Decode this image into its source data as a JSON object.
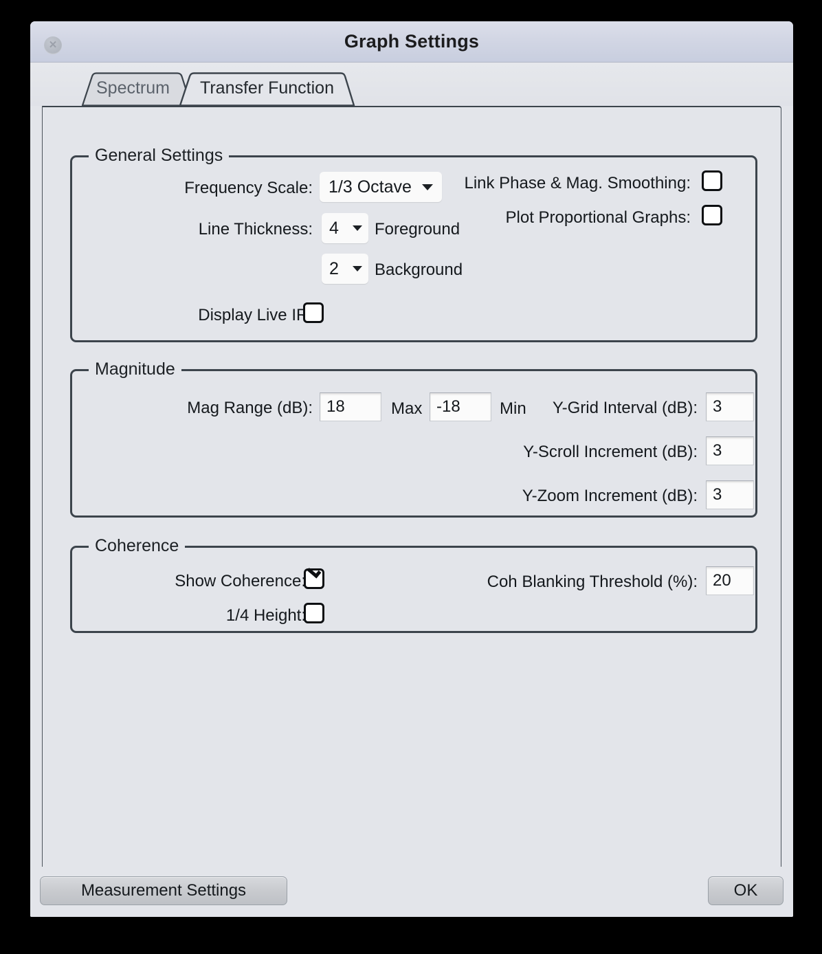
{
  "window": {
    "title": "Graph Settings",
    "close_icon": "close-icon",
    "close_glyph": "✕"
  },
  "tabs": [
    {
      "label": "Spectrum",
      "selected": false
    },
    {
      "label": "Transfer Function",
      "selected": true
    }
  ],
  "general": {
    "title": "General Settings",
    "frequency_scale": {
      "label": "Frequency Scale:",
      "value": "1/3 Octave"
    },
    "line_thickness": {
      "label": "Line Thickness:"
    },
    "foreground": {
      "value": "4",
      "label": "Foreground"
    },
    "background": {
      "value": "2",
      "label": "Background"
    },
    "display_live_ir": {
      "label": "Display Live IR:",
      "checked": false
    },
    "link_phase": {
      "label": "Link Phase & Mag. Smoothing:",
      "checked": false
    },
    "plot_proportional": {
      "label": "Plot Proportional Graphs:",
      "checked": false
    }
  },
  "magnitude": {
    "title": "Magnitude",
    "mag_range": {
      "label": "Mag Range (dB):",
      "max_value": "18",
      "max_label": "Max",
      "min_value": "-18",
      "min_label": "Min"
    },
    "y_grid": {
      "label": "Y-Grid Interval (dB):",
      "value": "3"
    },
    "y_scroll": {
      "label": "Y-Scroll Increment (dB):",
      "value": "3"
    },
    "y_zoom": {
      "label": "Y-Zoom Increment (dB):",
      "value": "3"
    }
  },
  "coherence": {
    "title": "Coherence",
    "show_coherence": {
      "label": "Show Coherence:",
      "checked": true
    },
    "quarter_height": {
      "label": "1/4 Height:",
      "checked": false
    },
    "blanking_threshold": {
      "label": "Coh Blanking Threshold (%):",
      "value": "20"
    }
  },
  "footer": {
    "measurement_settings": "Measurement Settings",
    "ok": "OK"
  },
  "colors": {
    "window_bg": "#e3e5ea",
    "group_border": "#3c444c",
    "titlebar_top": "#dcdfea",
    "titlebar_bottom": "#c8cedf",
    "text": "#15191d"
  }
}
